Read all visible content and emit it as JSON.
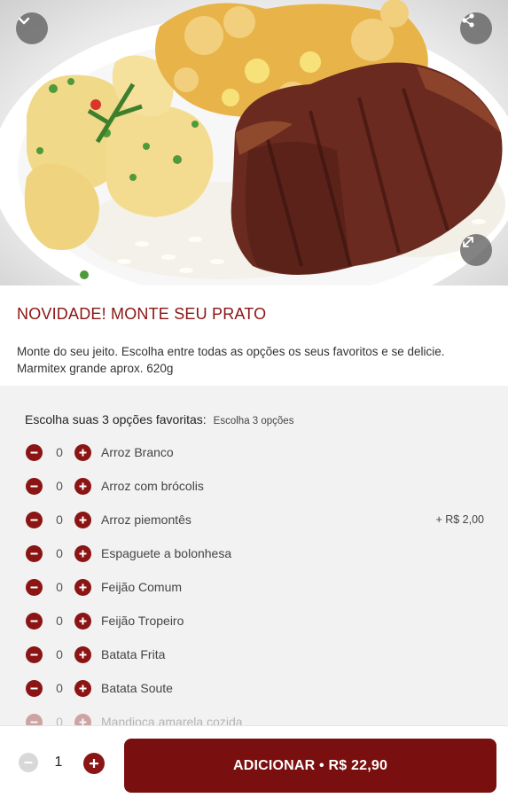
{
  "product": {
    "title": "NOVIDADE! MONTE SEU PRATO",
    "description": "Monte do seu jeito. Escolha entre todas as opções os seus favoritos e se delicie. Marmitex grande aprox. 620g"
  },
  "hero": {
    "collapse_icon": "chevron-down-icon",
    "share_icon": "share-icon",
    "expand_icon": "expand-icon"
  },
  "options": {
    "title": "Escolha suas 3 opções favoritas:",
    "subtitle": "Escolha 3 opções",
    "items": [
      {
        "name": "Arroz Branco",
        "qty": "0",
        "price": ""
      },
      {
        "name": "Arroz com brócolis",
        "qty": "0",
        "price": ""
      },
      {
        "name": "Arroz piemontês",
        "qty": "0",
        "price": "+ R$ 2,00"
      },
      {
        "name": "Espaguete a bolonhesa",
        "qty": "0",
        "price": ""
      },
      {
        "name": "Feijão Comum",
        "qty": "0",
        "price": ""
      },
      {
        "name": "Feijão Tropeiro",
        "qty": "0",
        "price": ""
      },
      {
        "name": "Batata Frita",
        "qty": "0",
        "price": ""
      },
      {
        "name": "Batata Soute",
        "qty": "0",
        "price": ""
      },
      {
        "name": "Mandioca amarela cozida",
        "qty": "0",
        "price": ""
      }
    ]
  },
  "cart": {
    "qty": "1",
    "add_label": "ADICIONAR • R$ 22,90"
  },
  "colors": {
    "accent": "#8b1414",
    "button": "#7a0f0f",
    "options_bg": "#f2f2f2"
  }
}
